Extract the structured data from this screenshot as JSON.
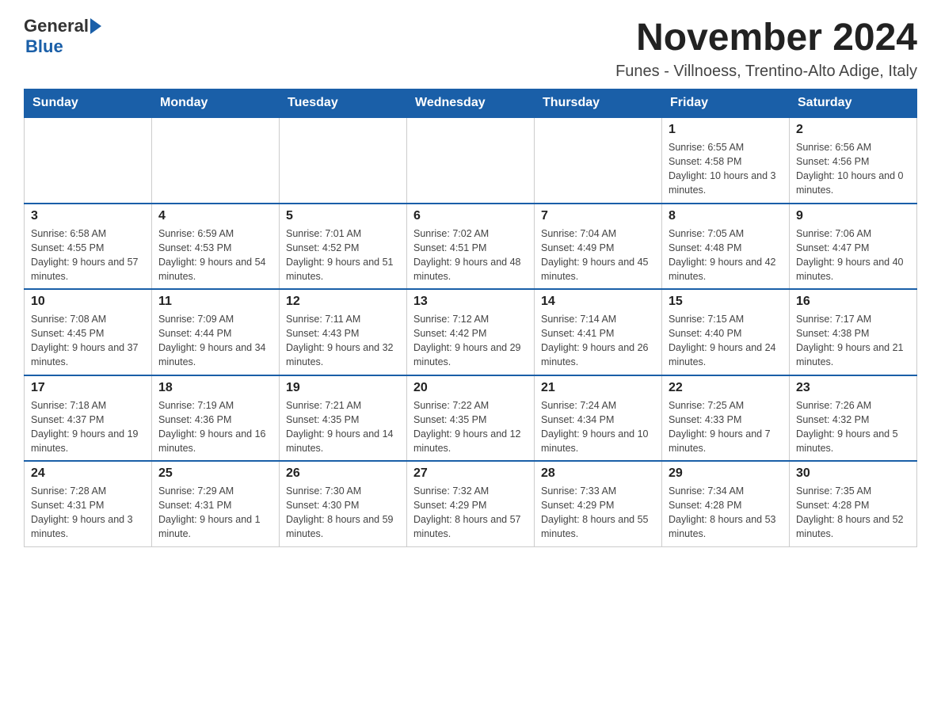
{
  "header": {
    "logo_general": "General",
    "logo_blue": "Blue",
    "title": "November 2024",
    "subtitle": "Funes - Villnoess, Trentino-Alto Adige, Italy"
  },
  "days_of_week": [
    "Sunday",
    "Monday",
    "Tuesday",
    "Wednesday",
    "Thursday",
    "Friday",
    "Saturday"
  ],
  "weeks": [
    {
      "days": [
        {
          "num": "",
          "info": ""
        },
        {
          "num": "",
          "info": ""
        },
        {
          "num": "",
          "info": ""
        },
        {
          "num": "",
          "info": ""
        },
        {
          "num": "",
          "info": ""
        },
        {
          "num": "1",
          "info": "Sunrise: 6:55 AM\nSunset: 4:58 PM\nDaylight: 10 hours and 3 minutes."
        },
        {
          "num": "2",
          "info": "Sunrise: 6:56 AM\nSunset: 4:56 PM\nDaylight: 10 hours and 0 minutes."
        }
      ]
    },
    {
      "days": [
        {
          "num": "3",
          "info": "Sunrise: 6:58 AM\nSunset: 4:55 PM\nDaylight: 9 hours and 57 minutes."
        },
        {
          "num": "4",
          "info": "Sunrise: 6:59 AM\nSunset: 4:53 PM\nDaylight: 9 hours and 54 minutes."
        },
        {
          "num": "5",
          "info": "Sunrise: 7:01 AM\nSunset: 4:52 PM\nDaylight: 9 hours and 51 minutes."
        },
        {
          "num": "6",
          "info": "Sunrise: 7:02 AM\nSunset: 4:51 PM\nDaylight: 9 hours and 48 minutes."
        },
        {
          "num": "7",
          "info": "Sunrise: 7:04 AM\nSunset: 4:49 PM\nDaylight: 9 hours and 45 minutes."
        },
        {
          "num": "8",
          "info": "Sunrise: 7:05 AM\nSunset: 4:48 PM\nDaylight: 9 hours and 42 minutes."
        },
        {
          "num": "9",
          "info": "Sunrise: 7:06 AM\nSunset: 4:47 PM\nDaylight: 9 hours and 40 minutes."
        }
      ]
    },
    {
      "days": [
        {
          "num": "10",
          "info": "Sunrise: 7:08 AM\nSunset: 4:45 PM\nDaylight: 9 hours and 37 minutes."
        },
        {
          "num": "11",
          "info": "Sunrise: 7:09 AM\nSunset: 4:44 PM\nDaylight: 9 hours and 34 minutes."
        },
        {
          "num": "12",
          "info": "Sunrise: 7:11 AM\nSunset: 4:43 PM\nDaylight: 9 hours and 32 minutes."
        },
        {
          "num": "13",
          "info": "Sunrise: 7:12 AM\nSunset: 4:42 PM\nDaylight: 9 hours and 29 minutes."
        },
        {
          "num": "14",
          "info": "Sunrise: 7:14 AM\nSunset: 4:41 PM\nDaylight: 9 hours and 26 minutes."
        },
        {
          "num": "15",
          "info": "Sunrise: 7:15 AM\nSunset: 4:40 PM\nDaylight: 9 hours and 24 minutes."
        },
        {
          "num": "16",
          "info": "Sunrise: 7:17 AM\nSunset: 4:38 PM\nDaylight: 9 hours and 21 minutes."
        }
      ]
    },
    {
      "days": [
        {
          "num": "17",
          "info": "Sunrise: 7:18 AM\nSunset: 4:37 PM\nDaylight: 9 hours and 19 minutes."
        },
        {
          "num": "18",
          "info": "Sunrise: 7:19 AM\nSunset: 4:36 PM\nDaylight: 9 hours and 16 minutes."
        },
        {
          "num": "19",
          "info": "Sunrise: 7:21 AM\nSunset: 4:35 PM\nDaylight: 9 hours and 14 minutes."
        },
        {
          "num": "20",
          "info": "Sunrise: 7:22 AM\nSunset: 4:35 PM\nDaylight: 9 hours and 12 minutes."
        },
        {
          "num": "21",
          "info": "Sunrise: 7:24 AM\nSunset: 4:34 PM\nDaylight: 9 hours and 10 minutes."
        },
        {
          "num": "22",
          "info": "Sunrise: 7:25 AM\nSunset: 4:33 PM\nDaylight: 9 hours and 7 minutes."
        },
        {
          "num": "23",
          "info": "Sunrise: 7:26 AM\nSunset: 4:32 PM\nDaylight: 9 hours and 5 minutes."
        }
      ]
    },
    {
      "days": [
        {
          "num": "24",
          "info": "Sunrise: 7:28 AM\nSunset: 4:31 PM\nDaylight: 9 hours and 3 minutes."
        },
        {
          "num": "25",
          "info": "Sunrise: 7:29 AM\nSunset: 4:31 PM\nDaylight: 9 hours and 1 minute."
        },
        {
          "num": "26",
          "info": "Sunrise: 7:30 AM\nSunset: 4:30 PM\nDaylight: 8 hours and 59 minutes."
        },
        {
          "num": "27",
          "info": "Sunrise: 7:32 AM\nSunset: 4:29 PM\nDaylight: 8 hours and 57 minutes."
        },
        {
          "num": "28",
          "info": "Sunrise: 7:33 AM\nSunset: 4:29 PM\nDaylight: 8 hours and 55 minutes."
        },
        {
          "num": "29",
          "info": "Sunrise: 7:34 AM\nSunset: 4:28 PM\nDaylight: 8 hours and 53 minutes."
        },
        {
          "num": "30",
          "info": "Sunrise: 7:35 AM\nSunset: 4:28 PM\nDaylight: 8 hours and 52 minutes."
        }
      ]
    }
  ]
}
